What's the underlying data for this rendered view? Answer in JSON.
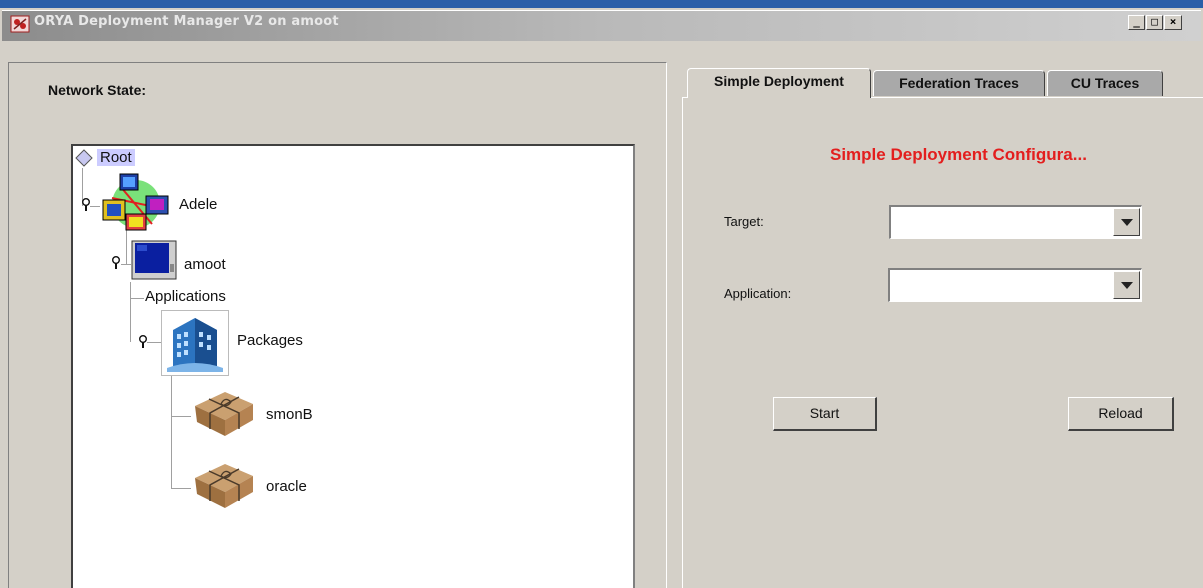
{
  "window": {
    "title": "ORYA Deployment Manager V2 on amoot",
    "buttons": {
      "minimize": "_",
      "maximize": "□",
      "close": "×"
    }
  },
  "left": {
    "label": "Network State:",
    "tree": {
      "root": "Root",
      "nodes": {
        "adele": "Adele",
        "amoot": "amoot",
        "applications": "Applications",
        "packages": "Packages",
        "smonB": "smonB",
        "oracle": "oracle"
      }
    }
  },
  "tabs": [
    {
      "label": "Simple Deployment",
      "selected": true
    },
    {
      "label": "Federation Traces",
      "selected": false
    },
    {
      "label": "CU Traces",
      "selected": false
    }
  ],
  "form": {
    "title": "Simple Deployment Configura...",
    "target_label": "Target:",
    "target_value": "",
    "application_label": "Application:",
    "application_value": "",
    "start_button": "Start",
    "reload_button": "Reload"
  },
  "colors": {
    "window_bg": "#d4d0c8",
    "config_title": "#e31e1e",
    "selection": "#ccccff"
  },
  "icons": {
    "app": "orya-app-icon",
    "root": "diamond-icon",
    "adele": "network-computers-icon",
    "amoot": "monitor-icon",
    "packages": "building-icon",
    "package": "parcel-icon",
    "toggle": "key-toggle-icon",
    "dropdown": "chevron-down-icon"
  }
}
